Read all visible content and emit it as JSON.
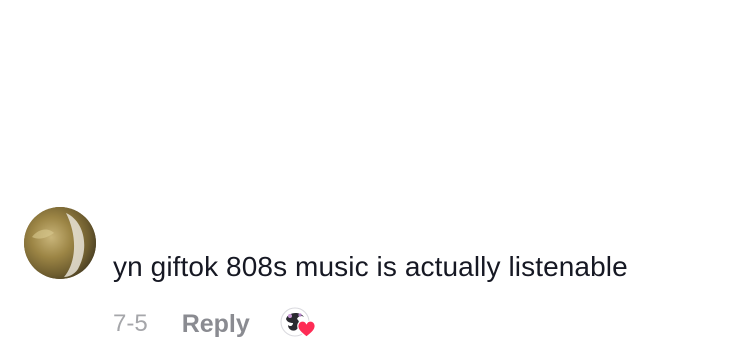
{
  "comment": {
    "text": "yn giftok 808s music is actually listenable",
    "date": "7-5",
    "reply_label": "Reply",
    "avatar_icon": "user-avatar",
    "creator_like_icon": "creator-liked-heart-icon",
    "colors": {
      "text": "#161823",
      "date": "#a5a6aa",
      "reply": "#8a8b91",
      "heart": "#fe2c55"
    }
  }
}
